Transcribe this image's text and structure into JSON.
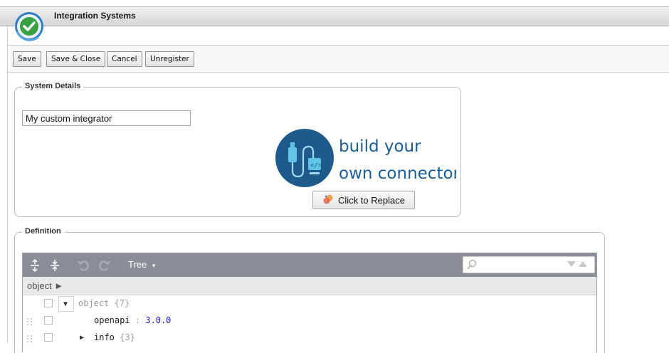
{
  "app": {
    "title": "Integration Systems"
  },
  "toolbar": {
    "save_label": "Save",
    "save_close_label": "Save & Close",
    "cancel_label": "Cancel",
    "unregister_label": "Unregister"
  },
  "system_details": {
    "legend": "System Details",
    "name_value": "My custom integrator",
    "logo_line1": "build your",
    "logo_line2": "own connector",
    "replace_label": "Click to Replace"
  },
  "definition": {
    "legend": "Definition",
    "editor": {
      "mode_label": "Tree",
      "breadcrumb": "object ►",
      "search_value": "",
      "tree": [
        {
          "key": "object",
          "meta": "{7}",
          "expanded": true
        },
        {
          "key": "openapi",
          "separator": ":",
          "value": "3.0.0"
        },
        {
          "key": "info",
          "meta": "{3}",
          "expanded": false
        }
      ]
    }
  },
  "colors": {
    "editor_menu": "#8a8f96",
    "logo_blue": "#1e5a8c",
    "logo_text": "#1b5e96",
    "string_value": "#1a1acc"
  }
}
